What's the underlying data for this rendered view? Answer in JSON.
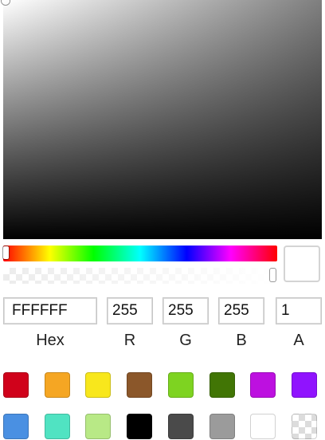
{
  "color": {
    "hex": "FFFFFF",
    "r": "255",
    "g": "255",
    "b": "255",
    "a": "1",
    "hue": 0,
    "alpha": 1,
    "preview": "#ffffff"
  },
  "labels": {
    "hex": "Hex",
    "r": "R",
    "g": "G",
    "b": "B",
    "a": "A"
  },
  "swatches": [
    [
      "#d0021b",
      "#f5a623",
      "#f8e71c",
      "#8b572a",
      "#7ed321",
      "#417505",
      "#bd10e0",
      "#9013fe"
    ],
    [
      "#4a90e2",
      "#50e3c2",
      "#b8e986",
      "#000000",
      "#4a4a4a",
      "#9b9b9b",
      "#ffffff",
      "transparent"
    ]
  ]
}
